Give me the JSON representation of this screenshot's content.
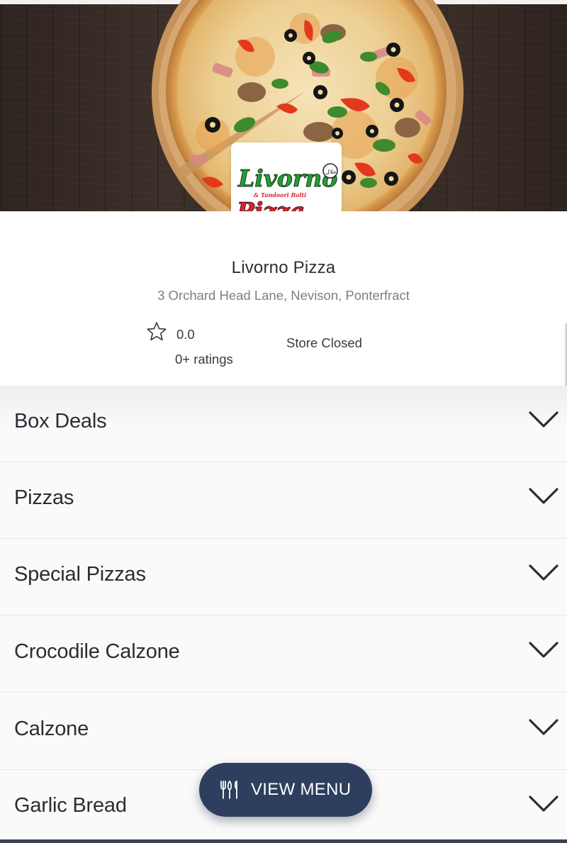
{
  "store": {
    "name": "Livorno Pizza",
    "address": "3 Orchard Head Lane, Nevison, Ponterfract",
    "rating": "0.0",
    "rating_count": "0+ ratings",
    "status": "Store Closed"
  },
  "logo": {
    "line1": "Livorno",
    "line2": "Pizza",
    "tagline": "& Tandoori Balti"
  },
  "categories": [
    "Box Deals",
    "Pizzas",
    "Special Pizzas",
    "Crocodile Calzone",
    "Calzone",
    "Garlic Bread"
  ],
  "view_menu": {
    "label": "VIEW MENU",
    "icon": "cutlery-icon"
  },
  "colors": {
    "button": "#2d3e5e",
    "logo_green": "#2a9a3a",
    "logo_red": "#d7262f"
  }
}
